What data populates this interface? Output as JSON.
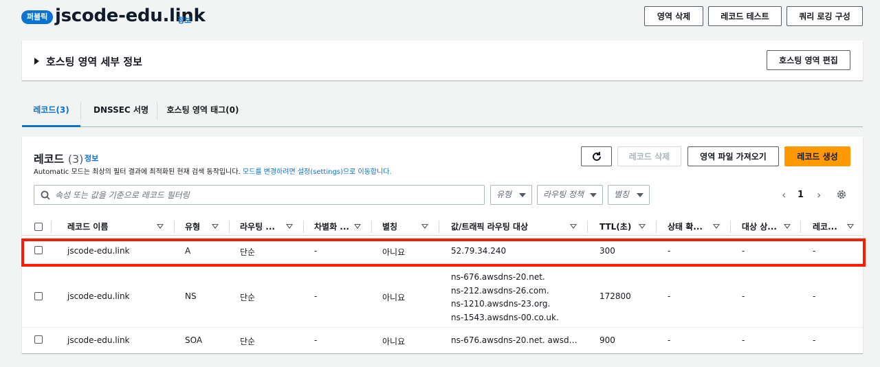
{
  "header": {
    "badge": "퍼블릭",
    "title": "jscode-edu.link",
    "info": "정보",
    "buttons": [
      "영역 삭제",
      "레코드 테스트",
      "쿼리 로깅 구성"
    ]
  },
  "hosted_zone_panel": {
    "toggle_label": "호스팅 영역 세부 정보",
    "edit_button": "호스팅 영역 편집"
  },
  "tabs": [
    "레코드(3)",
    "DNSSEC 서명",
    "호스팅 영역 태그(0)"
  ],
  "records": {
    "title": "레코드",
    "count": "(3)",
    "info": "정보",
    "description_prefix": "Automatic 모드는 최상의 필터 결과에 최적화된 현재 검색 동작입니다. ",
    "description_link": "모드를 변경하려면 설정(settings)으로 이동합니다.",
    "buttons": {
      "delete": "레코드 삭제",
      "import": "영역 파일 가져오기",
      "create": "레코드 생성"
    },
    "filter_placeholder": "속성 또는 값을 기준으로 레코드 필터링",
    "selects": [
      "유형",
      "라우팅 정책",
      "별칭"
    ],
    "page": "1",
    "columns": [
      "레코드 이름",
      "유형",
      "라우팅 ...",
      "차별화 ...",
      "별칭",
      "값/트래픽 라우팅 대상",
      "TTL(초)",
      "상태 확...",
      "대상 상...",
      "레코..."
    ],
    "rows": [
      {
        "name": "jscode-edu.link",
        "type": "A",
        "routing": "단순",
        "diff": "-",
        "alias": "아니요",
        "value": "52.79.34.240",
        "ttl": "300",
        "health": "-",
        "target": "-",
        "rec": "-"
      },
      {
        "name": "jscode-edu.link",
        "type": "NS",
        "routing": "단순",
        "diff": "-",
        "alias": "아니요",
        "values": [
          "ns-676.awsdns-20.net.",
          "ns-212.awsdns-26.com.",
          "ns-1210.awsdns-23.org.",
          "ns-1543.awsdns-00.co.uk."
        ],
        "ttl": "172800",
        "health": "-",
        "target": "-",
        "rec": "-"
      },
      {
        "name": "jscode-edu.link",
        "type": "SOA",
        "routing": "단순",
        "diff": "-",
        "alias": "아니요",
        "value": "ns-676.awsdns-20.net. awsd…",
        "ttl": "900",
        "health": "-",
        "target": "-",
        "rec": "-"
      }
    ]
  },
  "colors": {
    "accent": "#0972d3",
    "primary_button": "#ff9900",
    "highlight_box": "#ff1a00"
  }
}
